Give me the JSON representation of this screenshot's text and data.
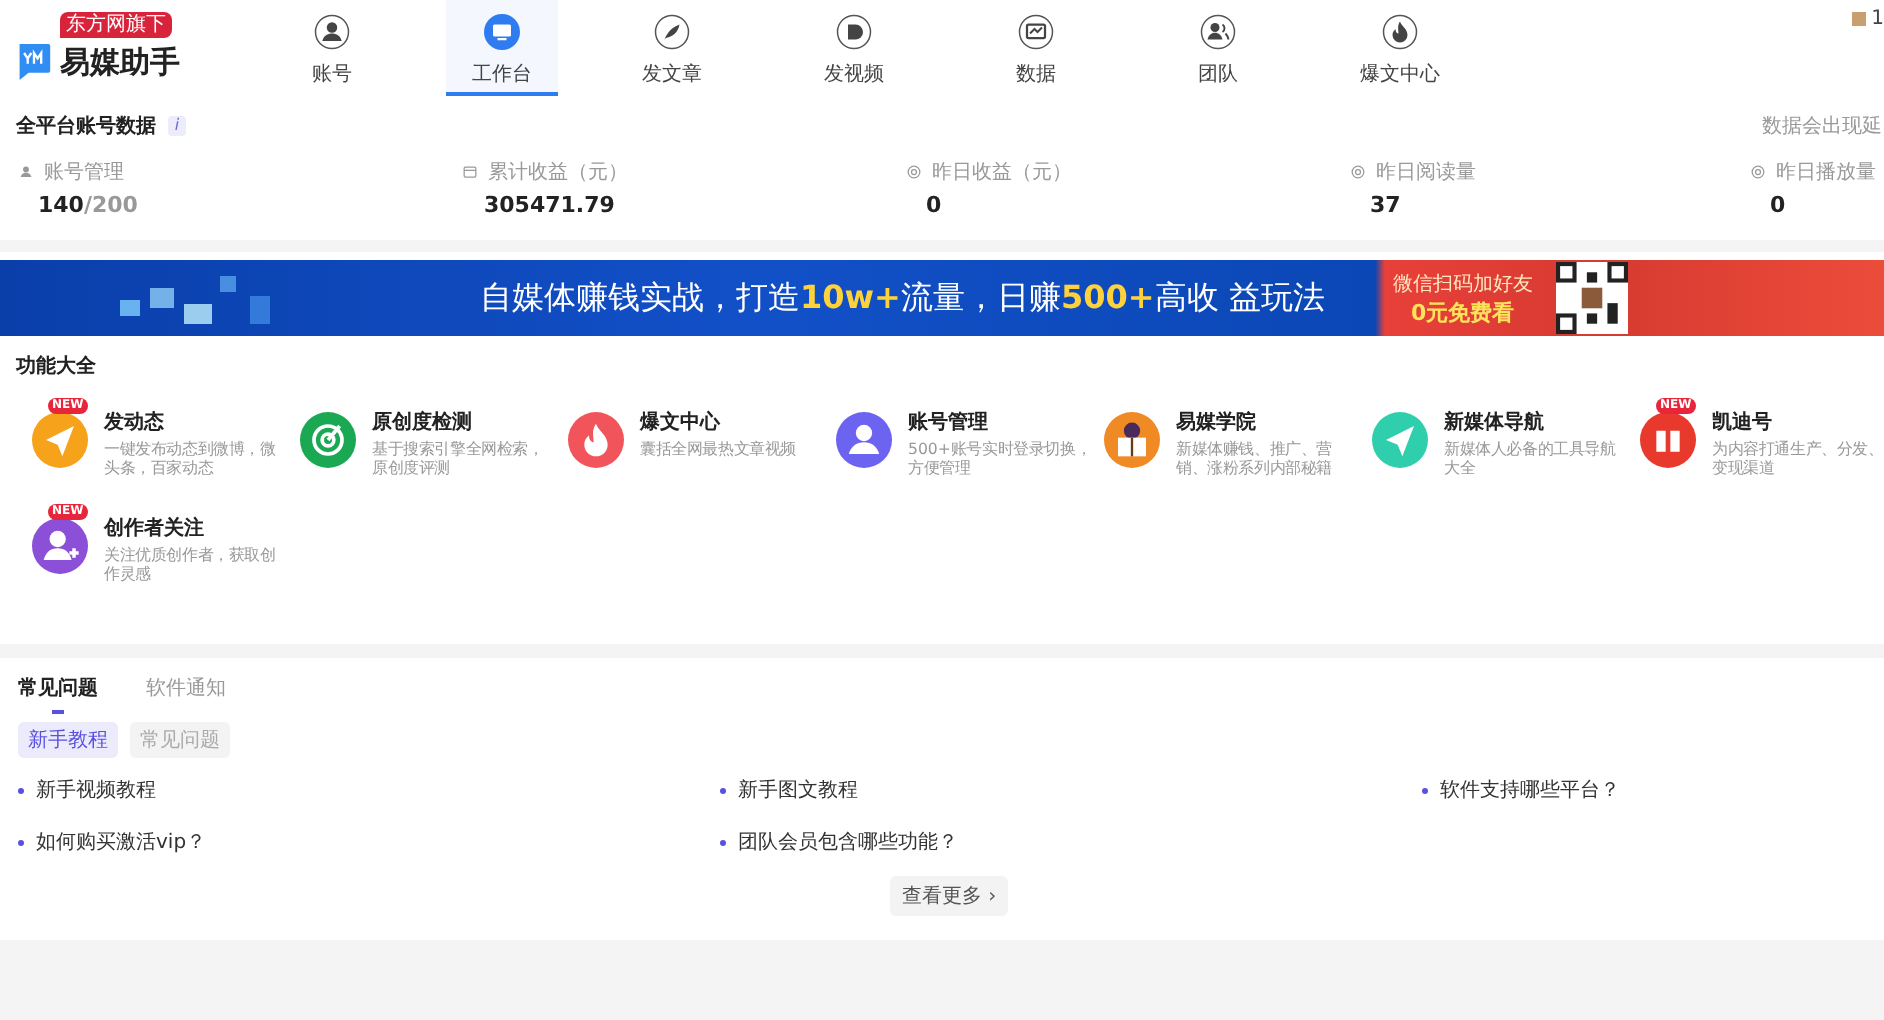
{
  "header": {
    "brand_badge": "东方网旗下",
    "brand": "易媒助手",
    "nav": [
      {
        "label": "账号",
        "kind": "person",
        "selected": false
      },
      {
        "label": "工作台",
        "kind": "monitor",
        "selected": true
      },
      {
        "label": "发文章",
        "kind": "pen",
        "selected": false
      },
      {
        "label": "发视频",
        "kind": "play",
        "selected": false
      },
      {
        "label": "数据",
        "kind": "chart",
        "selected": false
      },
      {
        "label": "团队",
        "kind": "team",
        "selected": false
      },
      {
        "label": "爆文中心",
        "kind": "fire",
        "selected": false
      }
    ],
    "user_fragment": "1"
  },
  "stats": {
    "title": "全平台账号数据",
    "info": "i",
    "note": "数据会出现延",
    "items": [
      {
        "label": "账号管理",
        "kind": "person",
        "value": "140",
        "total": "/200"
      },
      {
        "label": "累计收益（元）",
        "kind": "wallet",
        "value": "305471.79"
      },
      {
        "label": "昨日收益（元）",
        "kind": "target",
        "value": "0"
      },
      {
        "label": "昨日阅读量",
        "kind": "target",
        "value": "37"
      },
      {
        "label": "昨日播放量",
        "kind": "target",
        "value": "0"
      }
    ]
  },
  "banner": {
    "headline": "自媒体赚钱实战，打造**10w+**流量，日赚**500+**高收 益玩法",
    "cta_top": "微信扫码加好友",
    "cta": "0元免费看"
  },
  "features": {
    "title": "功能大全",
    "items": [
      {
        "name": "发动态",
        "desc": "一键发布动态到微博，微头条，百家动态",
        "kind": "plane",
        "color": "#f7a21b",
        "badge": "NEW"
      },
      {
        "name": "原创度检测",
        "desc": "基于搜索引擎全网检索，原创度评测",
        "kind": "radar",
        "color": "#1aa853"
      },
      {
        "name": "爆文中心",
        "desc": "囊括全网最热文章视频",
        "kind": "fire",
        "color": "#f2545b"
      },
      {
        "name": "账号管理",
        "desc": "500+账号实时登录切换，方便管理",
        "kind": "person",
        "color": "#6c63f0"
      },
      {
        "name": "易媒学院",
        "desc": "新媒体赚钱、推广、营销、涨粉系列内部秘籍",
        "kind": "book",
        "color": "#f08a24"
      },
      {
        "name": "新媒体导航",
        "desc": "新媒体人必备的工具导航大全",
        "kind": "plane",
        "color": "#2fcfae"
      },
      {
        "name": "凯迪号",
        "desc": "为内容打通生产、分发、变现渠道",
        "kind": "logo",
        "color": "#e8392c",
        "badge": "NEW"
      },
      {
        "name": "创作者关注",
        "desc": "关注优质创作者，获取创作灵感",
        "kind": "adduser",
        "color": "#8b4fd8",
        "badge": "NEW"
      }
    ]
  },
  "help": {
    "tabs": [
      {
        "label": "常见问题",
        "selected": true
      },
      {
        "label": "软件通知",
        "selected": false
      }
    ],
    "filters": [
      {
        "label": "新手教程",
        "selected": true
      },
      {
        "label": "常见问题",
        "selected": false
      }
    ],
    "links": [
      "新手视频教程",
      "新手图文教程",
      "软件支持哪些平台？",
      "如何购买激活vip？",
      "团队会员包含哪些功能？"
    ],
    "more": "查看更多 ›"
  }
}
